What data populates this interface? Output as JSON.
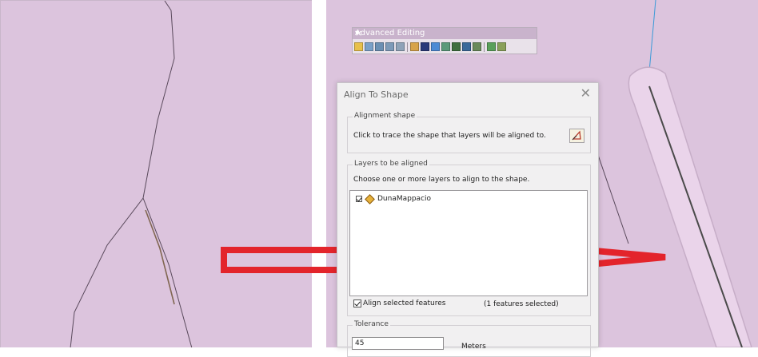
{
  "toolbar": {
    "title": "Advanced Editing",
    "dropdown_glyph": "▾",
    "close_glyph": "×",
    "tools": [
      {
        "name": "copy-features-icon",
        "color": "#e8c04a"
      },
      {
        "name": "fillet-icon",
        "color": "#7aa0c8"
      },
      {
        "name": "extend-icon",
        "color": "#6b8fb3"
      },
      {
        "name": "trim-icon",
        "color": "#7d9ab8"
      },
      {
        "name": "line-intersection-icon",
        "color": "#8fa3b8"
      },
      {
        "name": "explode-icon",
        "color": "#d7a34a"
      },
      {
        "name": "construct-geodetic-icon",
        "color": "#2a3a7a"
      },
      {
        "name": "align-to-shape-icon",
        "color": "#4d8ad4"
      },
      {
        "name": "replace-geometry-icon",
        "color": "#5a9a7a"
      },
      {
        "name": "construct-points-icon",
        "color": "#3f6f3f"
      },
      {
        "name": "generalize-icon",
        "color": "#3b6a9a"
      },
      {
        "name": "smooth-icon",
        "color": "#6a8a5a"
      },
      {
        "name": "rotate-icon",
        "color": "#5aa05a"
      },
      {
        "name": "buffer-icon",
        "color": "#8aa05a"
      }
    ]
  },
  "dialog": {
    "title": "Align To Shape",
    "close_glyph": "✕",
    "alignment_group": "Alignment shape",
    "alignment_hint": "Click to trace the shape that layers will be aligned to.",
    "layers_group": "Layers to be aligned",
    "layers_hint": "Choose one or more layers to align to the shape.",
    "layers": [
      {
        "name": "DunaMappacio",
        "checked": true
      }
    ],
    "align_selected_label": "Align selected features",
    "align_selected_checked": true,
    "selection_count": "(1 features selected)",
    "tolerance_group": "Tolerance",
    "tolerance_value": "45",
    "tolerance_units": "Meters"
  },
  "colors": {
    "map_fill": "#dcc4dd",
    "arrow": "#e3242b",
    "buffer": "#ead4ea"
  }
}
